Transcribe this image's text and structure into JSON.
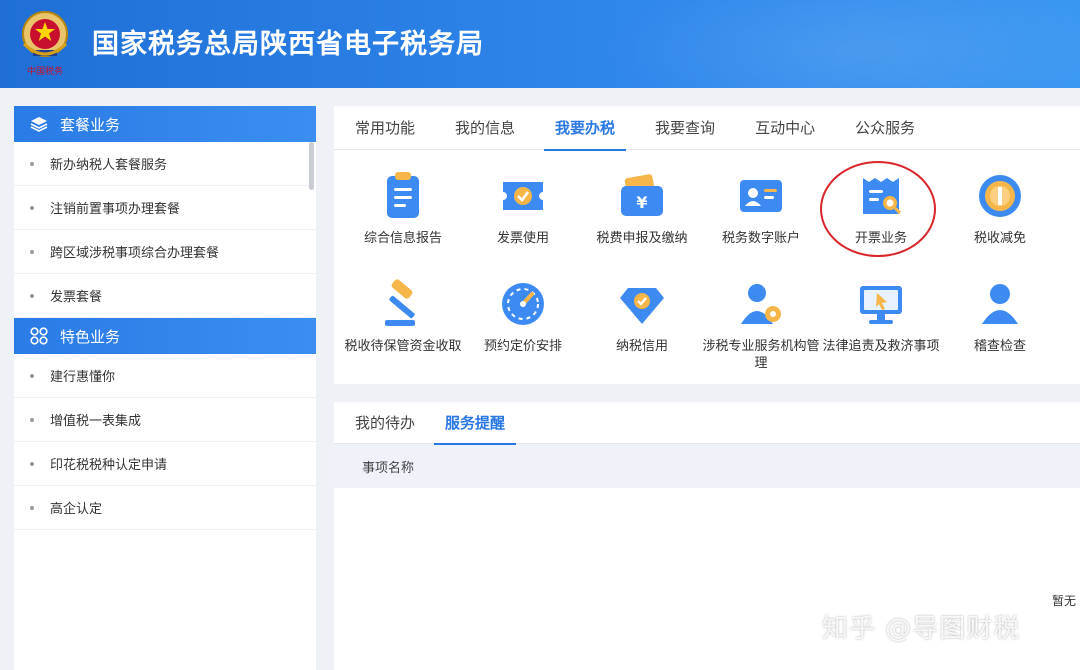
{
  "header": {
    "title": "国家税务总局陕西省电子税务局",
    "emblem_icon": "tax-emblem-icon",
    "emblem_text": "中国税务"
  },
  "sidebar": {
    "categories": [
      {
        "label": "套餐业务",
        "icon": "layers-icon",
        "items": [
          "新办纳税人套餐服务",
          "注销前置事项办理套餐",
          "跨区域涉税事项综合办理套餐",
          "发票套餐"
        ]
      },
      {
        "label": "特色业务",
        "icon": "grid-apps-icon",
        "items": [
          "建行惠懂你",
          "增值税一表集成",
          "印花税税种认定申请",
          "高企认定"
        ]
      }
    ]
  },
  "main": {
    "tabs": [
      "常用功能",
      "我的信息",
      "我要办税",
      "我要查询",
      "互动中心",
      "公众服务"
    ],
    "active_tab": "我要办税",
    "tiles": [
      {
        "label": "综合信息报告",
        "icon": "clipboard-icon"
      },
      {
        "label": "发票使用",
        "icon": "ticket-check-icon"
      },
      {
        "label": "税费申报及缴纳",
        "icon": "wallet-yen-icon"
      },
      {
        "label": "税务数字账户",
        "icon": "id-card-icon"
      },
      {
        "label": "开票业务",
        "icon": "invoice-search-icon"
      },
      {
        "label": "税收减免",
        "icon": "coin-icon"
      },
      {
        "label": "税收待保管资金收取",
        "icon": "gavel-icon"
      },
      {
        "label": "预约定价安排",
        "icon": "gauge-icon"
      },
      {
        "label": "纳税信用",
        "icon": "diamond-check-icon"
      },
      {
        "label": "涉税专业服务机构管理",
        "icon": "user-gear-icon"
      },
      {
        "label": "法律追责及救济事项",
        "icon": "monitor-pointer-icon"
      },
      {
        "label": "稽查检查",
        "icon": "user-icon"
      }
    ],
    "highlighted_tile": "开票业务"
  },
  "bottom": {
    "tabs": [
      "我的待办",
      "服务提醒"
    ],
    "active_tab": "服务提醒",
    "column_header": "事项名称",
    "empty_text": "暂无"
  },
  "watermark": "知乎 @导图财税",
  "colors": {
    "accent": "#2a78e4",
    "header_bg": "#2f86ea",
    "highlight_ring": "#d9252a"
  }
}
